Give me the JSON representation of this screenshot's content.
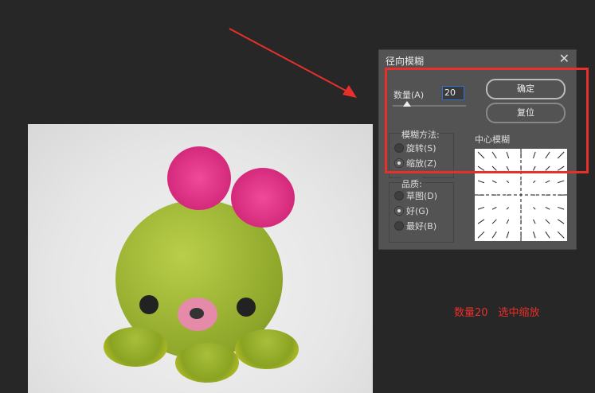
{
  "dialog": {
    "title": "径向模糊",
    "close": "✕",
    "amount_label": "数量(A)",
    "amount_value": "20",
    "amount_fraction": 0.2,
    "ok": "确定",
    "reset": "复位",
    "method_legend": "模糊方法:",
    "method_options": [
      "旋转(S)",
      "缩放(Z)"
    ],
    "method_selected": "缩放(Z)",
    "quality_legend": "品质:",
    "quality_options": [
      "草图(D)",
      "好(G)",
      "最好(B)"
    ],
    "quality_selected": "好(G)",
    "center_label": "中心模糊"
  },
  "annotation": {
    "text": "数量20　选中缩放",
    "color": "#e8302a"
  }
}
